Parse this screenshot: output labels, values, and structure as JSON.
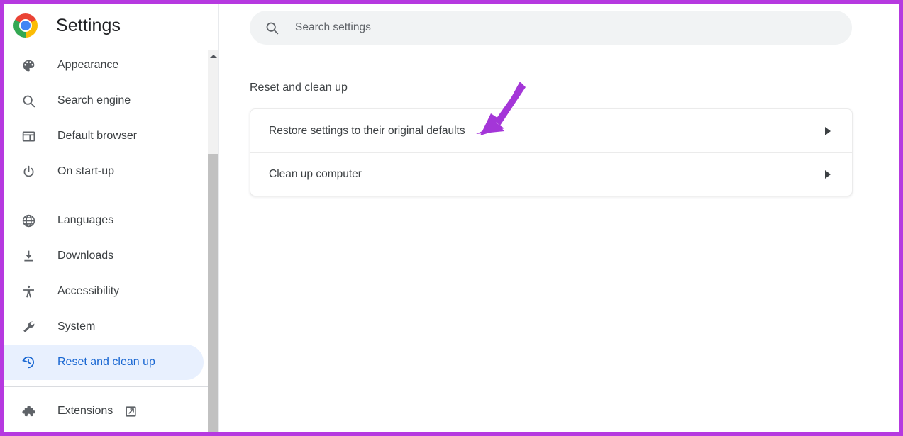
{
  "window": {
    "border_color": "#b639e0"
  },
  "sidebar": {
    "brand": {
      "logo_icon": "chrome-logo-icon",
      "title": "Settings"
    },
    "groups": [
      {
        "items": [
          {
            "icon": "palette-icon",
            "label": "Appearance",
            "selected": false
          },
          {
            "icon": "search-icon",
            "label": "Search engine",
            "selected": false
          },
          {
            "icon": "browser-icon",
            "label": "Default browser",
            "selected": false
          },
          {
            "icon": "power-icon",
            "label": "On start-up",
            "selected": false
          }
        ]
      },
      {
        "items": [
          {
            "icon": "globe-icon",
            "label": "Languages",
            "selected": false
          },
          {
            "icon": "download-icon",
            "label": "Downloads",
            "selected": false
          },
          {
            "icon": "accessibility-icon",
            "label": "Accessibility",
            "selected": false
          },
          {
            "icon": "wrench-icon",
            "label": "System",
            "selected": false
          },
          {
            "icon": "history-restore-icon",
            "label": "Reset and clean up",
            "selected": true
          }
        ]
      },
      {
        "items": [
          {
            "icon": "puzzle-icon",
            "label": "Extensions",
            "selected": false,
            "external_icon": "open-in-new-icon"
          }
        ]
      }
    ],
    "scrollbar": {
      "up_arrow_icon": "scroll-up-arrow-icon",
      "track_color": "#f1f1f1",
      "thumb_color": "#c1c1c1"
    },
    "selected_colors": {
      "background": "#e8f0fe",
      "text": "#1967d2"
    }
  },
  "main": {
    "search": {
      "icon": "search-icon",
      "placeholder": "Search settings",
      "value": ""
    },
    "section_title": "Reset and clean up",
    "card_rows": [
      {
        "label": "Restore settings to their original defaults",
        "chevron_icon": "chevron-right-icon"
      },
      {
        "label": "Clean up computer",
        "chevron_icon": "chevron-right-icon"
      }
    ]
  },
  "annotation": {
    "arrow_icon": "pointer-arrow-icon",
    "color": "#a436d8",
    "points_to": "Restore settings to their original defaults"
  }
}
